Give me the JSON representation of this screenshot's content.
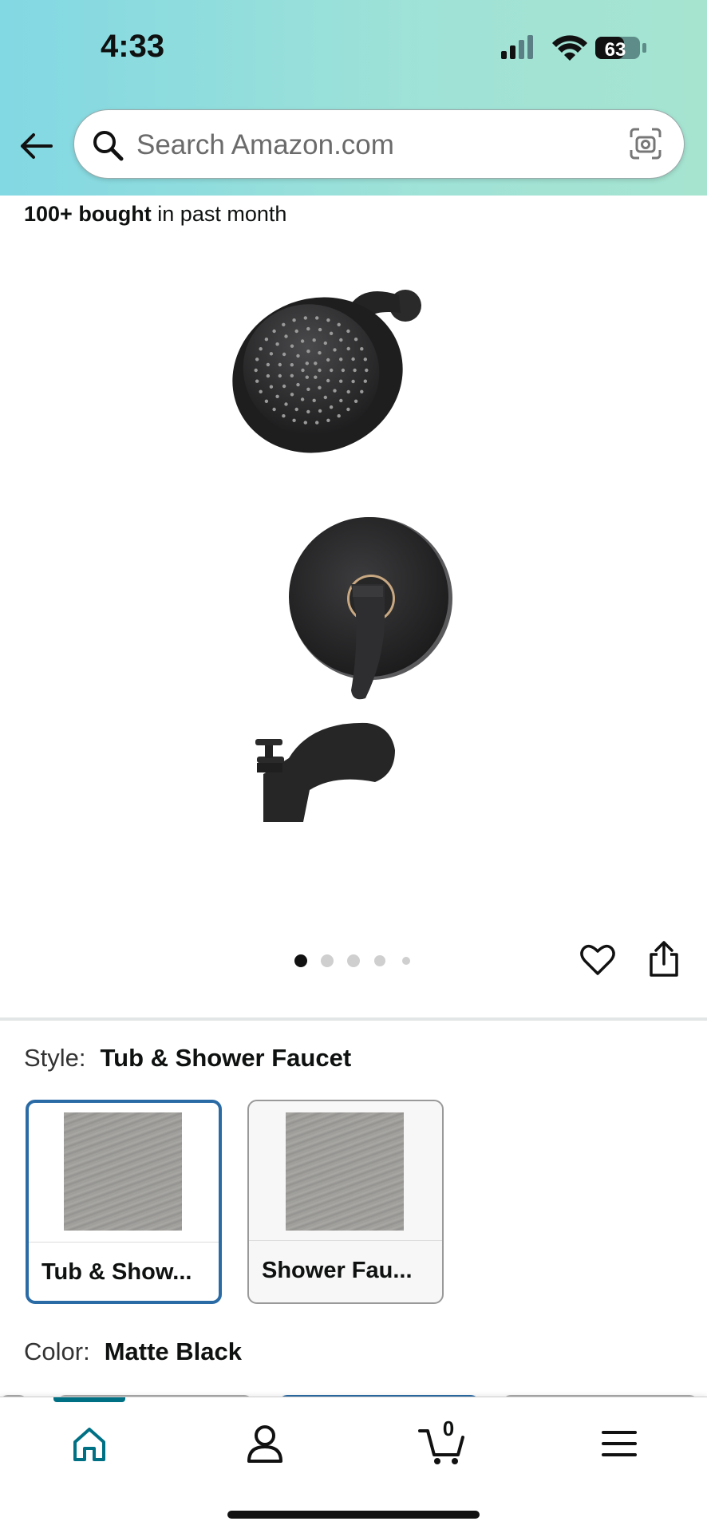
{
  "status_bar": {
    "time": "4:33",
    "battery": "63"
  },
  "search": {
    "placeholder": "Search Amazon.com"
  },
  "product": {
    "bought_strong": "100+ bought",
    "bought_rest": " in past month",
    "image_dots": {
      "count": 5,
      "active_index": 0
    }
  },
  "style": {
    "label": "Style:",
    "value": "Tub & Shower Faucet",
    "options": [
      {
        "label": "Tub & Show...",
        "selected": true
      },
      {
        "label": "Shower Fau...",
        "selected": false
      }
    ]
  },
  "color": {
    "label": "Color:",
    "value": "Matte Black"
  },
  "bottom_nav": {
    "cart_count": "0",
    "items": [
      "home-icon",
      "account-icon",
      "cart-icon",
      "menu-icon"
    ]
  },
  "colors": {
    "accent": "#007185",
    "selected_border": "#2a6ba6"
  }
}
